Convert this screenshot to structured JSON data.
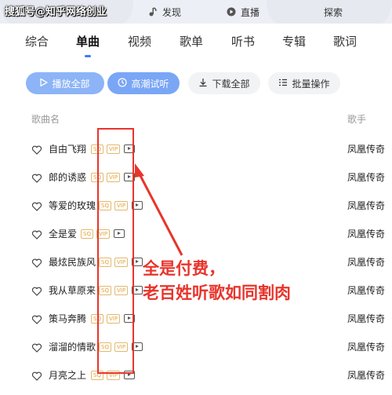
{
  "watermark": "搜狐号@知乎网络创业",
  "top_tabs": [
    {
      "label": "发现",
      "icon": "music-note-icon"
    },
    {
      "label": "直播",
      "icon": "live-icon"
    },
    {
      "label": "探索",
      "icon": ""
    }
  ],
  "categories": [
    "综合",
    "单曲",
    "视频",
    "歌单",
    "听书",
    "专辑",
    "歌词"
  ],
  "active_category": "单曲",
  "actions": {
    "play_all": "播放全部",
    "highlight": "高潮试听",
    "download_all": "下载全部",
    "batch": "批量操作"
  },
  "table": {
    "col_song": "歌曲名",
    "col_artist": "歌手"
  },
  "tags": {
    "sq": "SQ",
    "vip": "VIP"
  },
  "songs": [
    {
      "name": "自由飞翔",
      "artist": "凤凰传奇"
    },
    {
      "name": "郎的诱惑",
      "artist": "凤凰传奇"
    },
    {
      "name": "等爱的玫瑰",
      "artist": "凤凰传奇"
    },
    {
      "name": "全是爱",
      "artist": "凤凰传奇"
    },
    {
      "name": "最炫民族风",
      "artist": "凤凰传奇"
    },
    {
      "name": "我从草原来",
      "artist": "凤凰传奇"
    },
    {
      "name": "策马奔腾",
      "artist": "凤凰传奇"
    },
    {
      "name": "溜溜的情歌",
      "artist": "凤凰传奇"
    },
    {
      "name": "月亮之上",
      "artist": "凤凰传奇"
    }
  ],
  "annotation": {
    "line1": "全是付费，",
    "line2": "老百姓听歌如同割肉"
  },
  "colors": {
    "accent": "#3f7cf4",
    "annotation": "#e8342b",
    "vip_tag": "#e0a23e"
  }
}
